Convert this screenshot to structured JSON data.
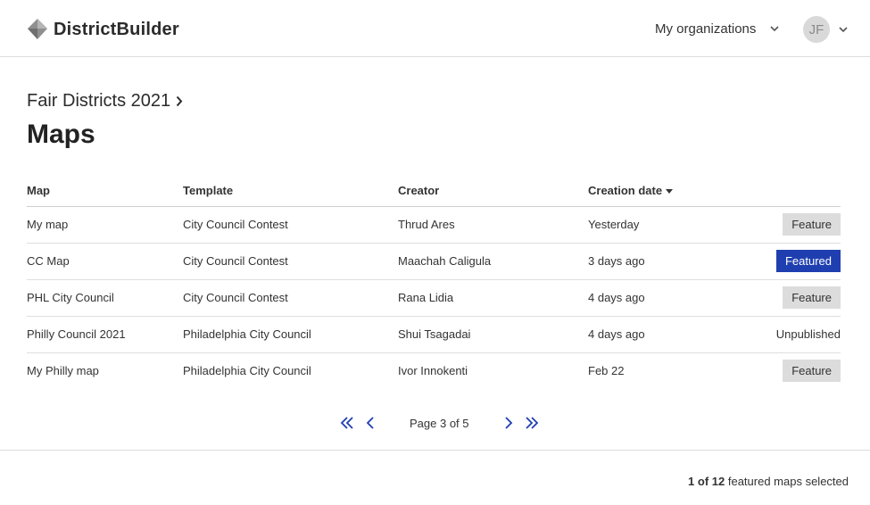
{
  "header": {
    "app_name": "DistrictBuilder",
    "org_menu_label": "My organizations",
    "user_initials": "JF"
  },
  "breadcrumb": {
    "label": "Fair Districts 2021"
  },
  "page": {
    "title": "Maps"
  },
  "table": {
    "headers": {
      "map": "Map",
      "template": "Template",
      "creator": "Creator",
      "date": "Creation date"
    },
    "rows": [
      {
        "map": "My map",
        "template": "City Council Contest",
        "creator": "Thrud Ares",
        "date": "Yesterday",
        "action": "Feature",
        "state": "feature"
      },
      {
        "map": "CC Map",
        "template": "City Council Contest",
        "creator": "Maachah Caligula",
        "date": "3 days ago",
        "action": "Featured",
        "state": "featured"
      },
      {
        "map": "PHL City Council",
        "template": "City Council Contest",
        "creator": "Rana Lidia",
        "date": "4 days ago",
        "action": "Feature",
        "state": "feature"
      },
      {
        "map": "Philly Council 2021",
        "template": "Philadelphia City Council",
        "creator": "Shui Tsagadai",
        "date": "4 days ago",
        "action": "Unpublished",
        "state": "unpublished"
      },
      {
        "map": "My Philly map",
        "template": "Philadelphia City Council",
        "creator": "Ivor Innokenti",
        "date": "Feb 22",
        "action": "Feature",
        "state": "feature"
      }
    ]
  },
  "pagination": {
    "label": "Page 3 of 5"
  },
  "footer": {
    "count": "1 of 12",
    "suffix": "featured maps selected"
  },
  "colors": {
    "featured_bg": "#1f3fb0",
    "feature_bg": "#dcdcdc",
    "pager_icon": "#1f3fb0"
  },
  "icons": {
    "logo": "districtbuilder-logo-icon",
    "chevron_down": "chevron-down-icon",
    "chevron_right": "chevron-right-icon",
    "first_page": "double-chevron-left-icon",
    "prev_page": "chevron-left-icon",
    "next_page": "chevron-right-icon",
    "last_page": "double-chevron-right-icon"
  }
}
